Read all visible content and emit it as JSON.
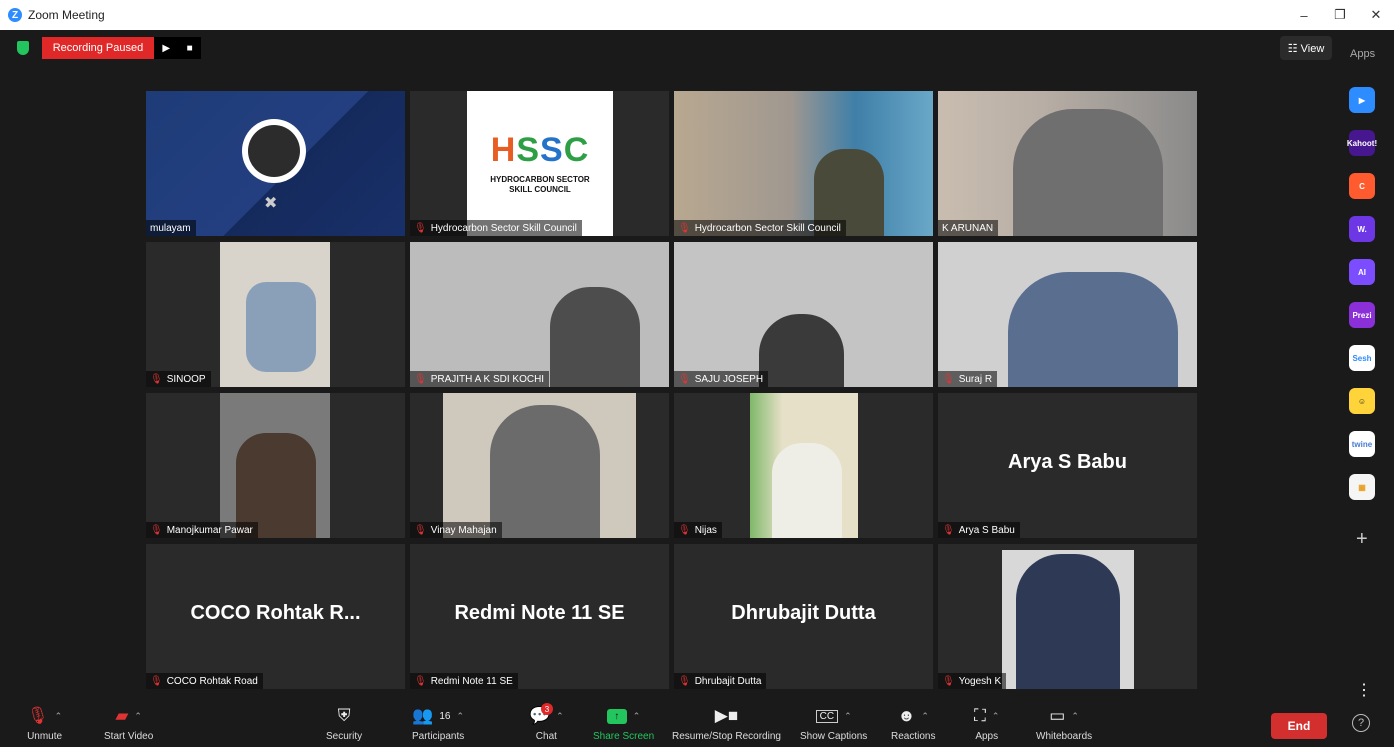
{
  "window": {
    "title": "Zoom Meeting",
    "minimize": "–",
    "restore": "❐",
    "close": "✕"
  },
  "recording": {
    "status": "Recording Paused",
    "play": "▶",
    "stop": "■"
  },
  "view_button": "☷ View",
  "apps_label": "Apps",
  "tiles": [
    {
      "name": "mulayam",
      "muted": false,
      "type": "obs"
    },
    {
      "name": "Hydrocarbon Sector Skill Council",
      "muted": true,
      "type": "logo"
    },
    {
      "name": "Hydrocarbon Sector Skill Council",
      "muted": true,
      "type": "video"
    },
    {
      "name": "K ARUNAN",
      "muted": false,
      "type": "video",
      "active": true
    },
    {
      "name": "SINOOP",
      "muted": true,
      "type": "video"
    },
    {
      "name": "PRAJITH A K SDI KOCHI",
      "muted": true,
      "type": "video"
    },
    {
      "name": "SAJU JOSEPH",
      "muted": true,
      "type": "video"
    },
    {
      "name": "Suraj R",
      "muted": true,
      "type": "video"
    },
    {
      "name": "Manojkumar Pawar",
      "muted": true,
      "type": "video"
    },
    {
      "name": "Vinay Mahajan",
      "muted": true,
      "type": "video"
    },
    {
      "name": "Nijas",
      "muted": true,
      "type": "video"
    },
    {
      "name": "Arya S Babu",
      "muted": true,
      "type": "name",
      "display": "Arya S Babu"
    },
    {
      "name": "COCO Rohtak Road",
      "muted": true,
      "type": "name",
      "display": "COCO Rohtak R..."
    },
    {
      "name": "Redmi Note 11 SE",
      "muted": true,
      "type": "name",
      "display": "Redmi Note 11 SE"
    },
    {
      "name": "Dhrubajit Dutta",
      "muted": true,
      "type": "name",
      "display": "Dhrubajit Dutta"
    },
    {
      "name": "Yogesh K",
      "muted": true,
      "type": "video"
    }
  ],
  "hssc": {
    "logo_h": "H",
    "logo_s1": "S",
    "logo_s2": "S",
    "logo_c": "C",
    "line1": "HYDROCARBON SECTOR",
    "line2": "SKILL COUNCIL"
  },
  "toolbar": {
    "unmute": "Unmute",
    "start_video": "Start Video",
    "security": "Security",
    "participants": "Participants",
    "participants_count": "16",
    "chat": "Chat",
    "chat_badge": "3",
    "share_screen": "Share Screen",
    "recording": "Resume/Stop Recording",
    "captions": "Show Captions",
    "reactions": "Reactions",
    "apps": "Apps",
    "whiteboards": "Whiteboards",
    "end": "End"
  },
  "side_apps": [
    {
      "name": "app-1",
      "color": "#2d8cff",
      "text": "▶"
    },
    {
      "name": "kahoot",
      "color": "#46178f",
      "text": "Kahoot!"
    },
    {
      "name": "app-3",
      "color": "#ff5b2e",
      "text": "C"
    },
    {
      "name": "wooclap",
      "color": "#6e37e6",
      "text": "W."
    },
    {
      "name": "ai-app",
      "color": "#7b4dff",
      "text": "AI"
    },
    {
      "name": "prezi",
      "color": "#8b2fd9",
      "text": "Prezi"
    },
    {
      "name": "sesh",
      "color": "#ffffff",
      "text": "Sesh"
    },
    {
      "name": "app-8",
      "color": "#ffd43b",
      "text": "☺"
    },
    {
      "name": "twine",
      "color": "#ffffff",
      "text": "twine"
    },
    {
      "name": "app-10",
      "color": "#f5f5f5",
      "text": "▦"
    }
  ],
  "colors": {
    "accent_green": "#23c55e",
    "record_red": "#e02828",
    "active_speaker": "#c6e36a",
    "end_red": "#d32f2f"
  }
}
